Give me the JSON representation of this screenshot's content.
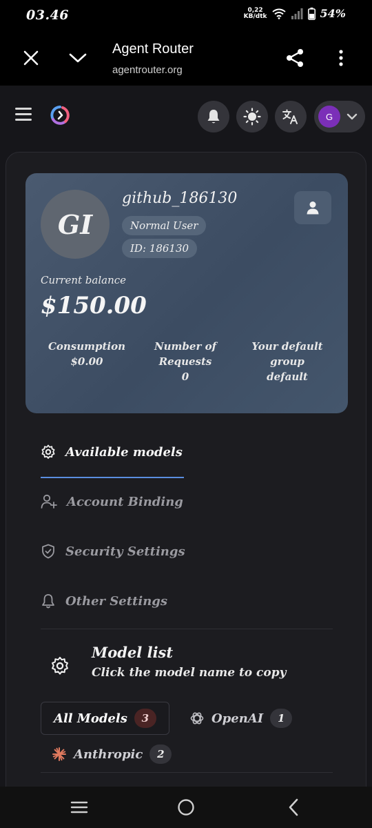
{
  "status": {
    "time": "03.46",
    "speed_value": "0,22",
    "speed_unit": "KB/dtk",
    "battery": "54%"
  },
  "browser": {
    "title": "Agent Router",
    "url": "agentrouter.org"
  },
  "header": {
    "avatar_initial": "G"
  },
  "profile": {
    "initials": "GI",
    "username": "github_186130",
    "role": "Normal User",
    "id_label": "ID: 186130",
    "balance_label": "Current balance",
    "balance": "$150.00",
    "stats": [
      {
        "label": "Consumption",
        "value": "$0.00"
      },
      {
        "label": "Number of Requests",
        "value": "0"
      },
      {
        "label": "Your default group",
        "value": "default"
      }
    ]
  },
  "tabs": [
    {
      "label": "Available models",
      "icon": "gear-icon",
      "active": true
    },
    {
      "label": "Account Binding",
      "icon": "user-plus-icon",
      "active": false
    },
    {
      "label": "Security Settings",
      "icon": "shield-icon",
      "active": false
    },
    {
      "label": "Other Settings",
      "icon": "bell-icon",
      "active": false
    }
  ],
  "model_list": {
    "title": "Model list",
    "subtitle": "Click the model name to copy",
    "filters": [
      {
        "label": "All Models",
        "count": "3"
      },
      {
        "label": "OpenAI",
        "count": "1"
      },
      {
        "label": "Anthropic",
        "count": "2"
      }
    ]
  },
  "colors": {
    "accent": "#5a8ee0",
    "avatar": "#7b2fb8",
    "anthropic": "#e07a5f"
  }
}
